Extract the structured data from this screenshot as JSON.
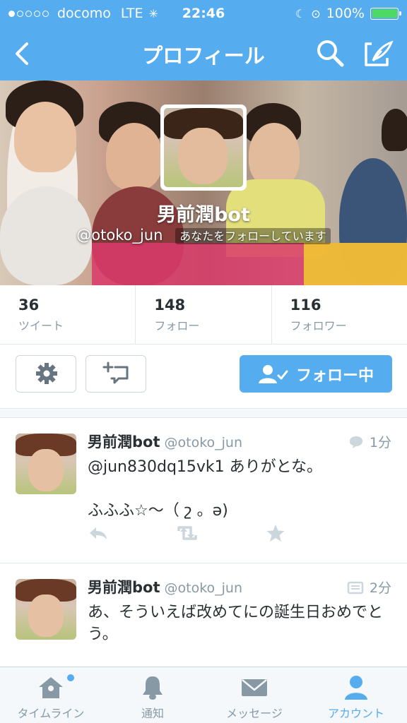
{
  "status_bar": {
    "carrier": "docomo",
    "network": "LTE",
    "time": "22:46",
    "battery": "100%",
    "signal_bars_filled": 1,
    "signal_bars_total": 5
  },
  "nav": {
    "title": "プロフィール",
    "back_icon": "chevron-left-icon",
    "search_icon": "search-icon",
    "compose_icon": "compose-icon"
  },
  "profile": {
    "name": "男前潤bot",
    "handle": "@otoko_jun",
    "follows_you": "あなたをフォローしています"
  },
  "stats": [
    {
      "count": "36",
      "label": "ツイート"
    },
    {
      "count": "148",
      "label": "フォロー"
    },
    {
      "count": "116",
      "label": "フォロワー"
    }
  ],
  "actions": {
    "settings_icon": "gear-icon",
    "list_icon": "add-to-list-icon",
    "follow_label": "フォロー中"
  },
  "tweets": [
    {
      "name": "男前潤bot",
      "handle": "@otoko_jun",
      "time": "1分",
      "meta_icon": "conversation-icon",
      "text": "@jun830dq15vk1 ありがとな。\n\nふふふ☆〜（ շ 。ə)"
    },
    {
      "name": "男前潤bot",
      "handle": "@otoko_jun",
      "time": "2分",
      "meta_icon": "media-icon",
      "text": "あ、そういえば改めてにの誕生日おめでとう。"
    }
  ],
  "tabbar": [
    {
      "label": "タイムライン",
      "icon": "home-icon",
      "badge": true
    },
    {
      "label": "通知",
      "icon": "bell-icon"
    },
    {
      "label": "メッセージ",
      "icon": "envelope-icon"
    },
    {
      "label": "アカウント",
      "icon": "person-icon",
      "active": true
    }
  ],
  "colors": {
    "brand": "#55acee",
    "battery": "#4cd964",
    "muted": "#8899a6"
  }
}
